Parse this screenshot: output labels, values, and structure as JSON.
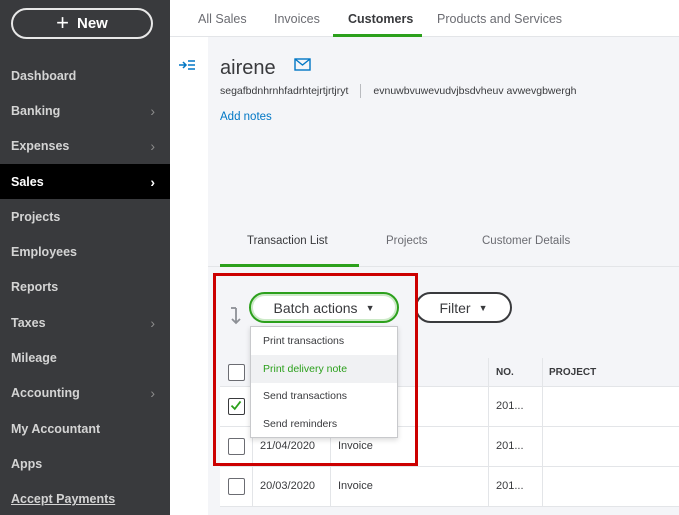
{
  "sidebar": {
    "new_label": "New",
    "items": [
      {
        "label": "Dashboard",
        "chevron": false,
        "active": false
      },
      {
        "label": "Banking",
        "chevron": true,
        "active": false
      },
      {
        "label": "Expenses",
        "chevron": true,
        "active": false
      },
      {
        "label": "Sales",
        "chevron": true,
        "active": true
      },
      {
        "label": "Projects",
        "chevron": false,
        "active": false
      },
      {
        "label": "Employees",
        "chevron": false,
        "active": false
      },
      {
        "label": "Reports",
        "chevron": false,
        "active": false
      },
      {
        "label": "Taxes",
        "chevron": true,
        "active": false
      },
      {
        "label": "Mileage",
        "chevron": false,
        "active": false
      },
      {
        "label": "Accounting",
        "chevron": true,
        "active": false
      },
      {
        "label": "My Accountant",
        "chevron": false,
        "active": false
      },
      {
        "label": "Apps",
        "chevron": false,
        "active": false
      },
      {
        "label": "Accept Payments",
        "chevron": false,
        "active": false
      }
    ]
  },
  "top_tabs": [
    "All Sales",
    "Invoices",
    "Customers",
    "Products and Services"
  ],
  "customer": {
    "name": "airene",
    "company": "segafbdnhrnhfadrhtejrtjrtjryt",
    "address": "evnuwbvuwevudvjbsdvheuv avwevgbwergh",
    "add_notes": "Add notes"
  },
  "sub_tabs": [
    "Transaction List",
    "Projects",
    "Customer Details"
  ],
  "toolbar": {
    "batch_label": "Batch actions",
    "filter_label": "Filter"
  },
  "batch_menu": [
    "Print transactions",
    "Print delivery note",
    "Send transactions",
    "Send reminders"
  ],
  "table": {
    "headers": {
      "no": "NO.",
      "project": "PROJECT"
    },
    "rows": [
      {
        "date": "",
        "type": "",
        "no": "201...",
        "checked": true
      },
      {
        "date": "21/04/2020",
        "type": "Invoice",
        "no": "201...",
        "checked": false
      },
      {
        "date": "20/03/2020",
        "type": "Invoice",
        "no": "201...",
        "checked": false
      }
    ]
  },
  "colors": {
    "sidebar_bg": "#393a3d",
    "accent_green": "#2ca01c",
    "link_blue": "#0077c5",
    "highlight_red": "#cc0000"
  }
}
